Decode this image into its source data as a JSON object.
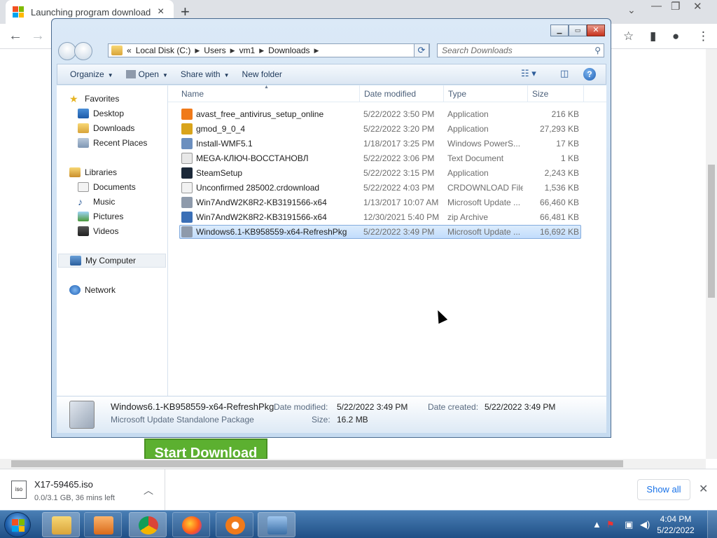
{
  "browser": {
    "tab_title": "Launching program download W",
    "tab_close": "×",
    "new_tab": "+",
    "minimize": "—",
    "restore": "❐",
    "close": "✕"
  },
  "page": {
    "start_download": "Start Download"
  },
  "download_shelf": {
    "file_name": "X17-59465.iso",
    "status": "0.0/3.1 GB, 36 mins left",
    "file_icon_label": "iso",
    "show_all": "Show all"
  },
  "explorer": {
    "breadcrumb": [
      "«",
      "Local Disk (C:)",
      "Users",
      "vm1",
      "Downloads"
    ],
    "search_placeholder": "Search Downloads",
    "commands": {
      "organize": "Organize",
      "open": "Open",
      "share_with": "Share with",
      "new_folder": "New folder"
    },
    "nav": {
      "favorites": "Favorites",
      "desktop": "Desktop",
      "downloads": "Downloads",
      "recent_places": "Recent Places",
      "libraries": "Libraries",
      "documents": "Documents",
      "music": "Music",
      "pictures": "Pictures",
      "videos": "Videos",
      "my_computer": "My Computer",
      "network": "Network"
    },
    "columns": {
      "name": "Name",
      "date_modified": "Date modified",
      "type": "Type",
      "size": "Size"
    },
    "files": [
      {
        "name": "avast_free_antivirus_setup_online",
        "date": "5/22/2022 3:50 PM",
        "type": "Application",
        "size": "216 KB",
        "icon": "avast-icon",
        "color": "#f07a1a"
      },
      {
        "name": "gmod_9_0_4",
        "date": "5/22/2022 3:20 PM",
        "type": "Application",
        "size": "27,293 KB",
        "icon": "gmod-icon",
        "color": "#d9a41c"
      },
      {
        "name": "Install-WMF5.1",
        "date": "1/18/2017 3:25 PM",
        "type": "Windows PowerS...",
        "size": "17 KB",
        "icon": "script-icon",
        "color": "#6b8fbf"
      },
      {
        "name": "MEGA-КЛЮЧ-ВОССТАНОВЛ",
        "date": "5/22/2022 3:06 PM",
        "type": "Text Document",
        "size": "1 KB",
        "icon": "text-file-icon",
        "color": "#e8e8e8"
      },
      {
        "name": "SteamSetup",
        "date": "5/22/2022 3:15 PM",
        "type": "Application",
        "size": "2,243 KB",
        "icon": "steam-icon",
        "color": "#1b2838"
      },
      {
        "name": "Unconfirmed 285002.crdownload",
        "date": "5/22/2022 4:03 PM",
        "type": "CRDOWNLOAD File",
        "size": "1,536 KB",
        "icon": "blank-file-icon",
        "color": "#f2f2f2"
      },
      {
        "name": "Win7AndW2K8R2-KB3191566-x64",
        "date": "1/13/2017 10:07 AM",
        "type": "Microsoft Update ...",
        "size": "66,460 KB",
        "icon": "update-package-icon",
        "color": "#8e9aab"
      },
      {
        "name": "Win7AndW2K8R2-KB3191566-x64",
        "date": "12/30/2021 5:40 PM",
        "type": "zip Archive",
        "size": "66,481 KB",
        "icon": "zip-icon",
        "color": "#3b6fb6"
      },
      {
        "name": "Windows6.1-KB958559-x64-RefreshPkg",
        "date": "5/22/2022 3:49 PM",
        "type": "Microsoft Update ...",
        "size": "16,692 KB",
        "icon": "update-package-icon",
        "color": "#8e9aab"
      }
    ],
    "details": {
      "name": "Windows6.1-KB958559-x64-RefreshPkg",
      "type": "Microsoft Update Standalone Package",
      "date_modified_label": "Date modified:",
      "date_modified": "5/22/2022 3:49 PM",
      "date_created_label": "Date created:",
      "date_created": "5/22/2022 3:49 PM",
      "size_label": "Size:",
      "size": "16.2 MB"
    }
  },
  "taskbar": {
    "time": "4:04 PM",
    "date": "5/22/2022"
  }
}
